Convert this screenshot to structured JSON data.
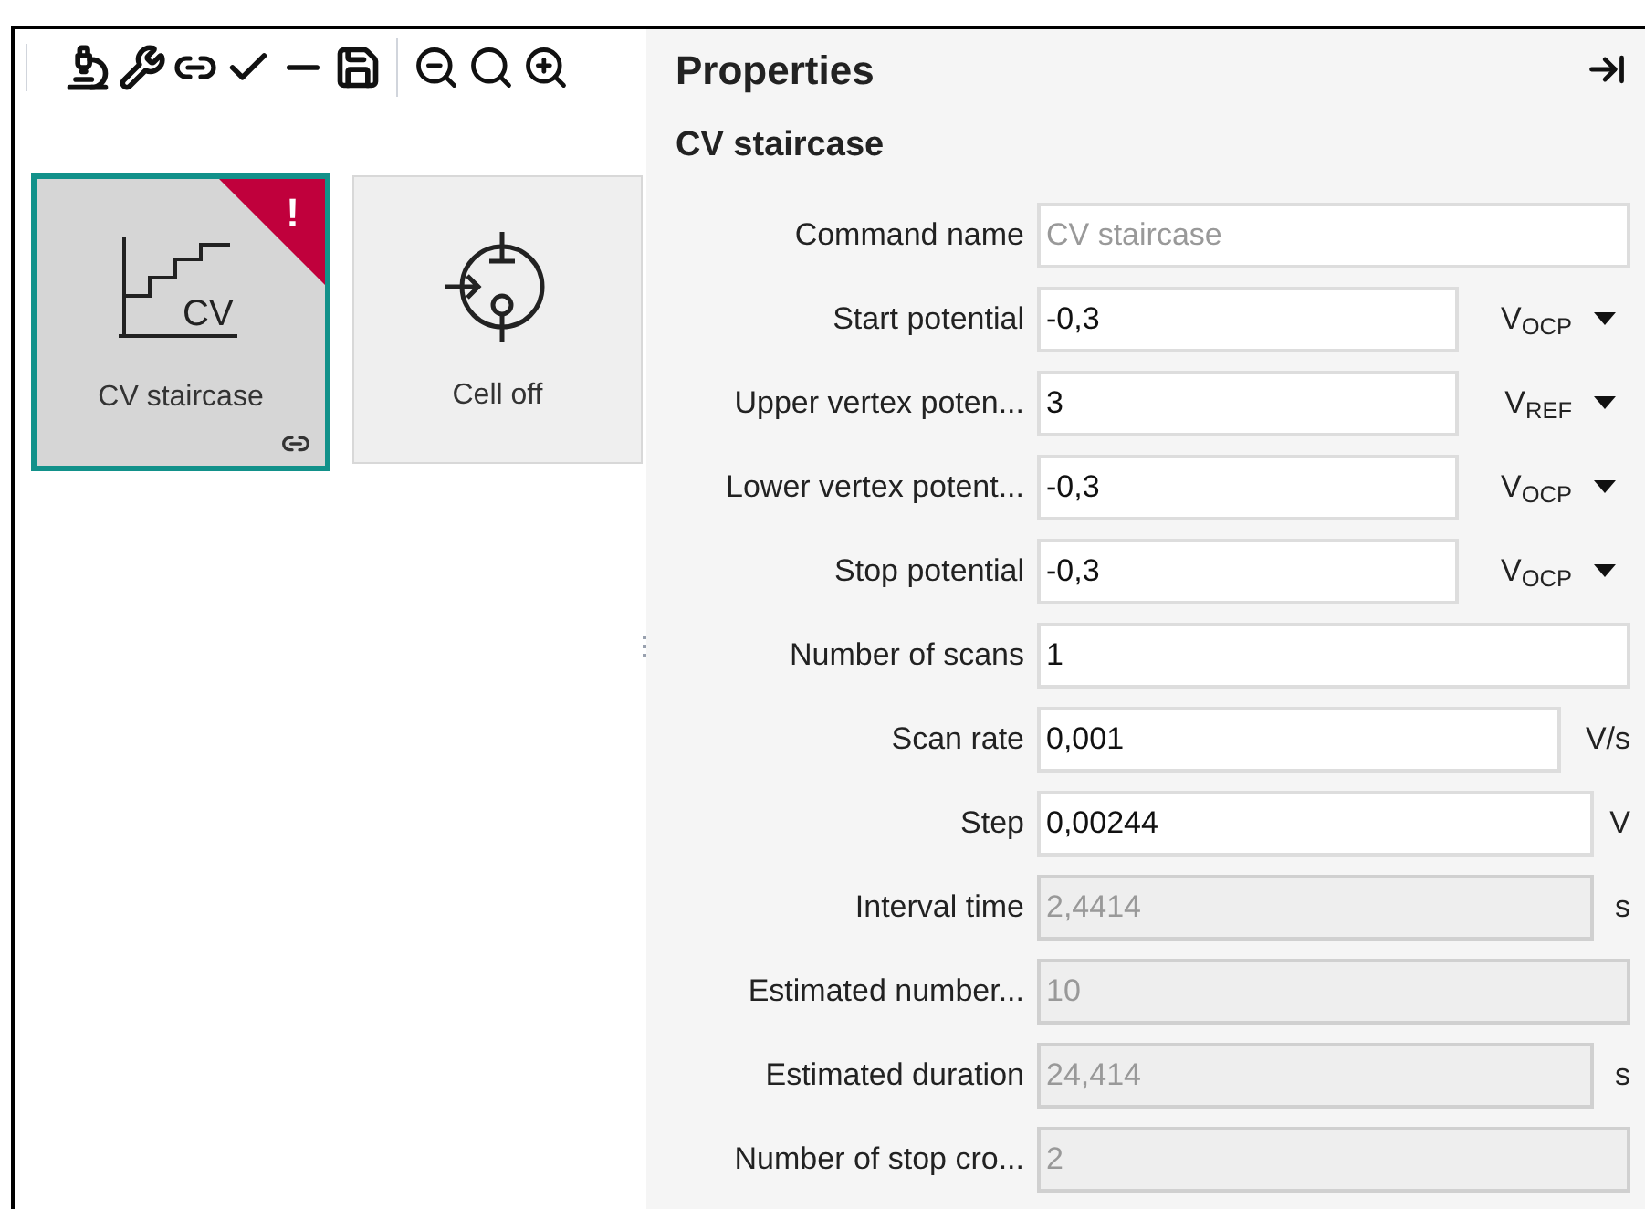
{
  "tiles": [
    {
      "label": "CV staircase",
      "selected": true,
      "kind": "staircase",
      "icon_text": "CV",
      "badge": "!",
      "linked": true
    },
    {
      "label": "Cell off",
      "selected": false,
      "kind": "cell",
      "linked": false
    }
  ],
  "properties": {
    "title": "Properties",
    "subtitle": "CV staircase",
    "rows": [
      {
        "label": "Command name",
        "placeholder": "CV staircase",
        "disabled": false
      },
      {
        "label": "Start potential",
        "value": "-0,3",
        "disabled": false,
        "unit": "V$_{OCP}$",
        "dropdown": true
      },
      {
        "label": "Upper vertex poten...",
        "value": "3",
        "disabled": false,
        "unit": "V$_{REF}$",
        "dropdown": true
      },
      {
        "label": "Lower vertex potent...",
        "value": "-0,3",
        "disabled": false,
        "unit": "V$_{OCP}$",
        "dropdown": true
      },
      {
        "label": "Stop potential",
        "value": "-0,3",
        "disabled": false,
        "unit": "V$_{OCP}$",
        "dropdown": true
      },
      {
        "label": "Number of scans",
        "value": "1",
        "disabled": false
      },
      {
        "label": "Scan rate",
        "value": "0,001",
        "disabled": false,
        "unit": "V/s",
        "dropdown": false
      },
      {
        "label": "Step",
        "value": "0,00244",
        "disabled": false,
        "unit": "V",
        "dropdown": false
      },
      {
        "label": "Interval time",
        "value": "2,4414",
        "disabled": true,
        "unit": "s",
        "dropdown": false
      },
      {
        "label": "Estimated number...",
        "value": "10",
        "disabled": true
      },
      {
        "label": "Estimated duration",
        "value": "24,414",
        "disabled": true,
        "unit": "s",
        "dropdown": false
      },
      {
        "label": "Number of stop cro...",
        "value": "2",
        "disabled": true
      }
    ]
  }
}
